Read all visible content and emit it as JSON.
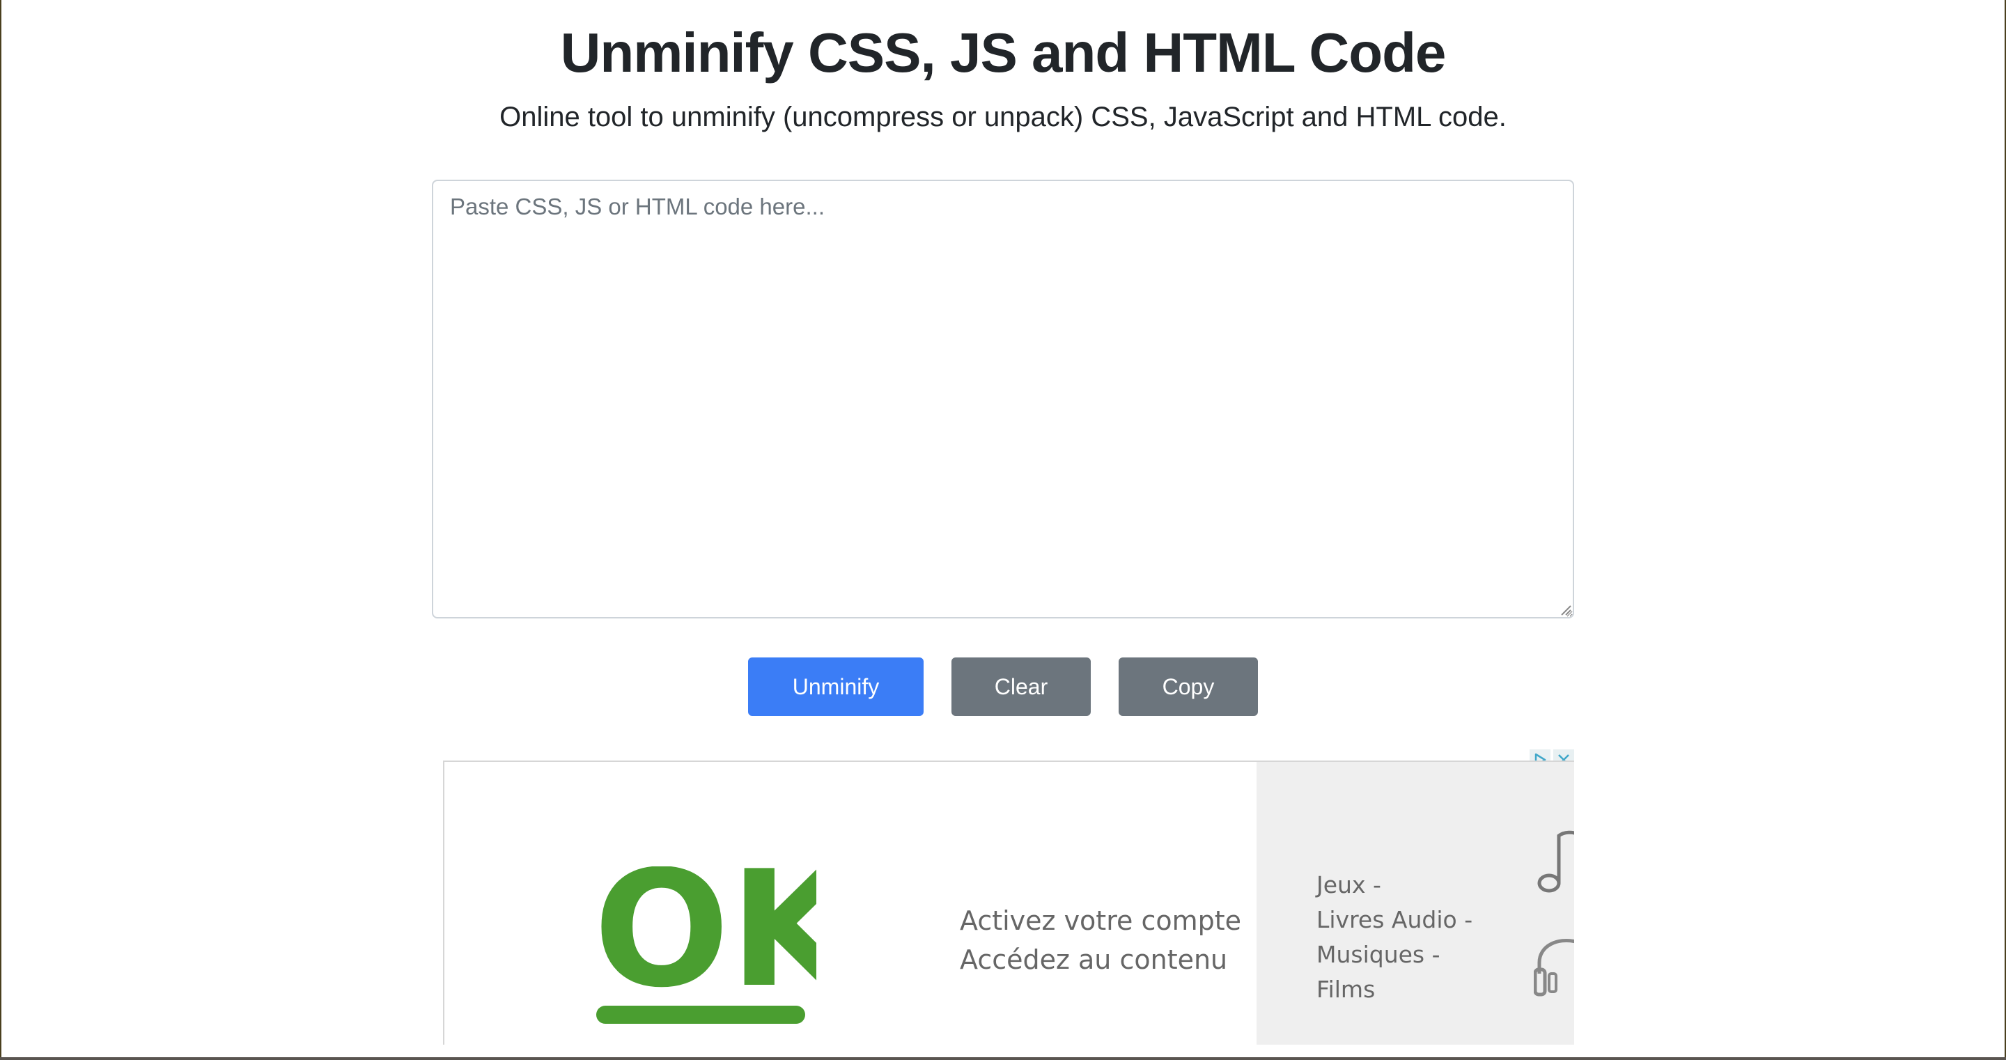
{
  "header": {
    "title": "Unminify CSS, JS and HTML Code",
    "subtitle": "Online tool to unminify (uncompress or unpack) CSS, JavaScript and HTML code."
  },
  "editor": {
    "placeholder": "Paste CSS, JS or HTML code here...",
    "value": ""
  },
  "actions": {
    "unminify_label": "Unminify",
    "clear_label": "Clear",
    "copy_label": "Copy"
  },
  "ad": {
    "logo_text": "OK",
    "line1": "Activez votre compte",
    "line2": "Accédez au contenu",
    "categories": [
      "Jeux -",
      "Livres Audio -",
      "Musiques -",
      "Films"
    ],
    "icons": [
      "music-note-icon",
      "headphones-icon",
      "adchoices-icon",
      "close-icon"
    ]
  },
  "colors": {
    "primary": "#3b7df6",
    "secondary": "#6c757d",
    "ok_green": "#4a9e30"
  }
}
